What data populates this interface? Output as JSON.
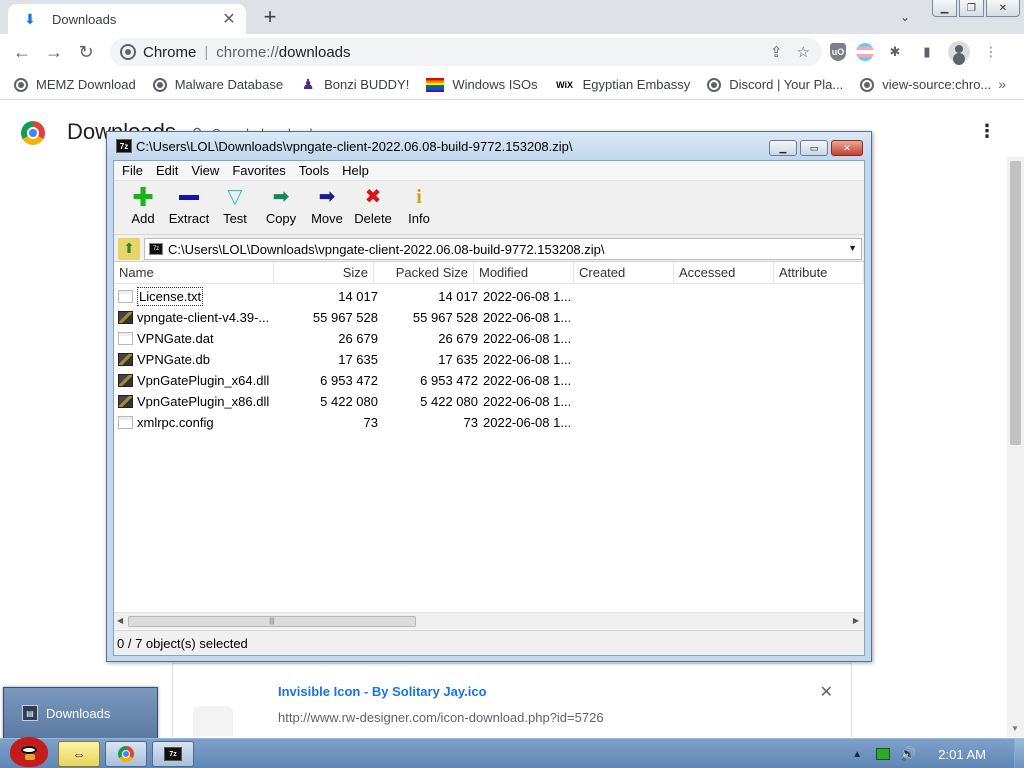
{
  "browser": {
    "tab_title": "Downloads",
    "tab_close": "✕",
    "new_tab": "+",
    "omnibox": {
      "chip": "Chrome",
      "url_scheme": "chrome://",
      "url_path": "downloads"
    },
    "bookmarks": [
      {
        "label": "MEMZ Download",
        "icon": "globe-icon"
      },
      {
        "label": "Malware Database",
        "icon": "globe-icon"
      },
      {
        "label": "Bonzi BUDDY!",
        "icon": "bonzi-icon"
      },
      {
        "label": "Windows ISOs",
        "icon": "rainbow-flag-icon"
      },
      {
        "label": "Egyptian Embassy",
        "icon": "wix-icon"
      },
      {
        "label": "Discord | Your Pla...",
        "icon": "globe-icon"
      },
      {
        "label": "view-source:chro...",
        "icon": "globe-icon"
      }
    ],
    "bookmarks_more": "»"
  },
  "downloads_page": {
    "heading": "Downloads",
    "search_placeholder": "Search downloads",
    "card": {
      "file_name": "Invisible Icon - By Solitary Jay.ico",
      "file_url": "http://www.rw-designer.com/icon-download.php?id=5726"
    }
  },
  "zip": {
    "title": "C:\\Users\\LOL\\Downloads\\vpngate-client-2022.06.08-build-9772.153208.zip\\",
    "app_icon_text": "7z",
    "menu": [
      "File",
      "Edit",
      "View",
      "Favorites",
      "Tools",
      "Help"
    ],
    "tools": {
      "add": "Add",
      "extract": "Extract",
      "test": "Test",
      "copy": "Copy",
      "move": "Move",
      "delete": "Delete",
      "info": "Info"
    },
    "address": "C:\\Users\\LOL\\Downloads\\vpngate-client-2022.06.08-build-9772.153208.zip\\",
    "columns": {
      "name": "Name",
      "size": "Size",
      "packed": "Packed Size",
      "modified": "Modified",
      "created": "Created",
      "accessed": "Accessed",
      "attributes": "Attribute"
    },
    "files": [
      {
        "name": "License.txt",
        "size": "14 017",
        "packed": "14 017",
        "modified": "2022-06-08 1...",
        "type": "text"
      },
      {
        "name": "vpngate-client-v4.39-...",
        "size": "55 967 528",
        "packed": "55 967 528",
        "modified": "2022-06-08 1...",
        "type": "binary"
      },
      {
        "name": "VPNGate.dat",
        "size": "26 679",
        "packed": "26 679",
        "modified": "2022-06-08 1...",
        "type": "text"
      },
      {
        "name": "VPNGate.db",
        "size": "17 635",
        "packed": "17 635",
        "modified": "2022-06-08 1...",
        "type": "binary"
      },
      {
        "name": "VpnGatePlugin_x64.dll",
        "size": "6 953 472",
        "packed": "6 953 472",
        "modified": "2022-06-08 1...",
        "type": "binary"
      },
      {
        "name": "VpnGatePlugin_x86.dll",
        "size": "5 422 080",
        "packed": "5 422 080",
        "modified": "2022-06-08 1...",
        "type": "binary"
      },
      {
        "name": "xmlrpc.config",
        "size": "73",
        "packed": "73",
        "modified": "2022-06-08 1...",
        "type": "text"
      }
    ],
    "status": "0 / 7 object(s) selected"
  },
  "taskbar": {
    "clock": "2:01 AM",
    "preview_label": "Downloads"
  },
  "colors": {
    "chrome_accent": "#1a73e8",
    "zip_frame": "#c4d8ec",
    "taskbar": "#6a8fbd"
  }
}
